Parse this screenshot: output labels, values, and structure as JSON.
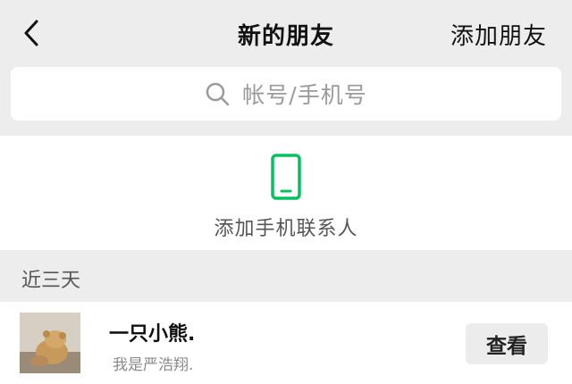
{
  "header": {
    "title": "新的朋友",
    "add_friend_label": "添加朋友",
    "back_icon": "chevron-left-icon"
  },
  "search": {
    "placeholder": "帐号/手机号",
    "icon": "search-icon"
  },
  "add_phone": {
    "label": "添加手机联系人",
    "icon": "phone-icon",
    "icon_color": "#07c160"
  },
  "section": {
    "label": "近三天"
  },
  "requests": [
    {
      "name": "一只小熊.",
      "message": "我是严浩翔.",
      "action_label": "查看"
    }
  ]
}
